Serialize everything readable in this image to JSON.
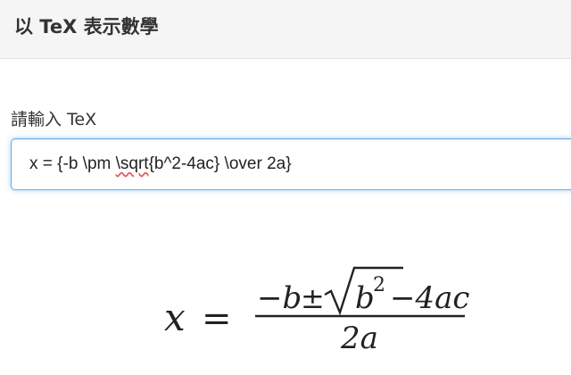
{
  "header": {
    "title": "以 TeX 表示數學"
  },
  "form": {
    "label": "請輸入 TeX",
    "input_value": {
      "before": "x = {-b \\pm ",
      "misspelled": "\\sqrt",
      "after": "{b^2-4ac} \\over 2a}"
    }
  },
  "rendered_math": {
    "lhs_var": "x",
    "equals": "=",
    "numerator": {
      "minus_b": "−b",
      "pm": "±",
      "radicand_b": "b",
      "exponent": "2",
      "minus_4ac": "−4ac"
    },
    "denominator": "2a"
  }
}
